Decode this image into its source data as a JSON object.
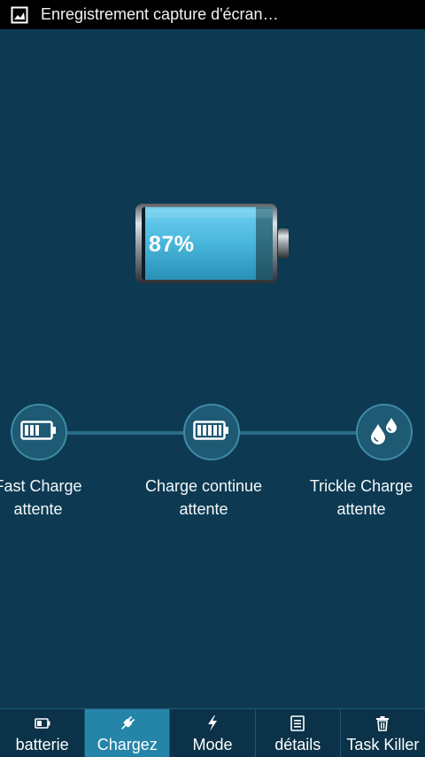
{
  "status_bar": {
    "notification_text": "Enregistrement capture d'écran…"
  },
  "battery": {
    "level_percent": 87,
    "level_text": "87%"
  },
  "stages": [
    {
      "name": "Fast Charge",
      "status": "attente",
      "icon": "battery-half-icon"
    },
    {
      "name": "Charge continue",
      "status": "attente",
      "icon": "battery-full-icon"
    },
    {
      "name": "Trickle Charge",
      "status": "attente",
      "icon": "droplets-icon"
    }
  ],
  "bottom_nav": {
    "active_index": 1,
    "items": [
      {
        "label": "batterie",
        "icon": "battery-icon"
      },
      {
        "label": "Chargez",
        "icon": "plug-icon"
      },
      {
        "label": "Mode",
        "icon": "lightning-icon"
      },
      {
        "label": "détails",
        "icon": "list-icon"
      },
      {
        "label": "Task Killer",
        "icon": "trash-icon"
      }
    ]
  },
  "colors": {
    "background": "#0d3a52",
    "accent": "#2585a8",
    "battery_fill": "#4cb8de"
  }
}
